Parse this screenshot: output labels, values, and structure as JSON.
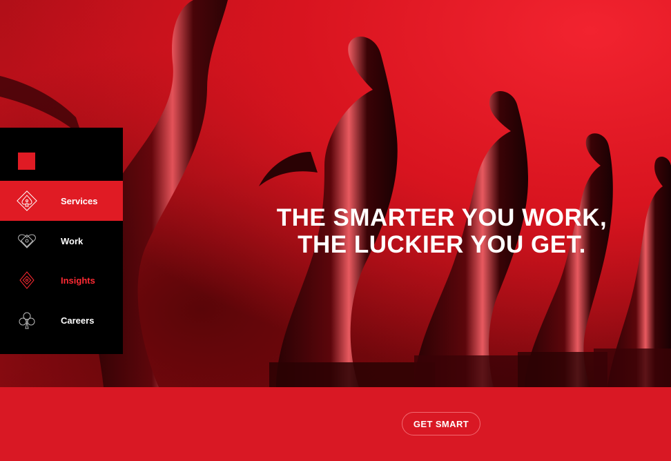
{
  "hero": {
    "headline_line1": "THE SMARTER YOU WORK,",
    "headline_line2": "THE LUCKIER YOU GET."
  },
  "nav": {
    "items": [
      {
        "label": "Services",
        "icon": "spade-icon",
        "state": "active"
      },
      {
        "label": "Work",
        "icon": "heart-icon",
        "state": "default"
      },
      {
        "label": "Insights",
        "icon": "diamond-icon",
        "state": "highlighted"
      },
      {
        "label": "Careers",
        "icon": "club-icon",
        "state": "default"
      }
    ]
  },
  "cta": {
    "label": "GET SMART"
  },
  "colors": {
    "brand_red": "#e01b24",
    "nav_background": "#000000",
    "cta_border": "#f26a71",
    "text": "#ffffff"
  }
}
